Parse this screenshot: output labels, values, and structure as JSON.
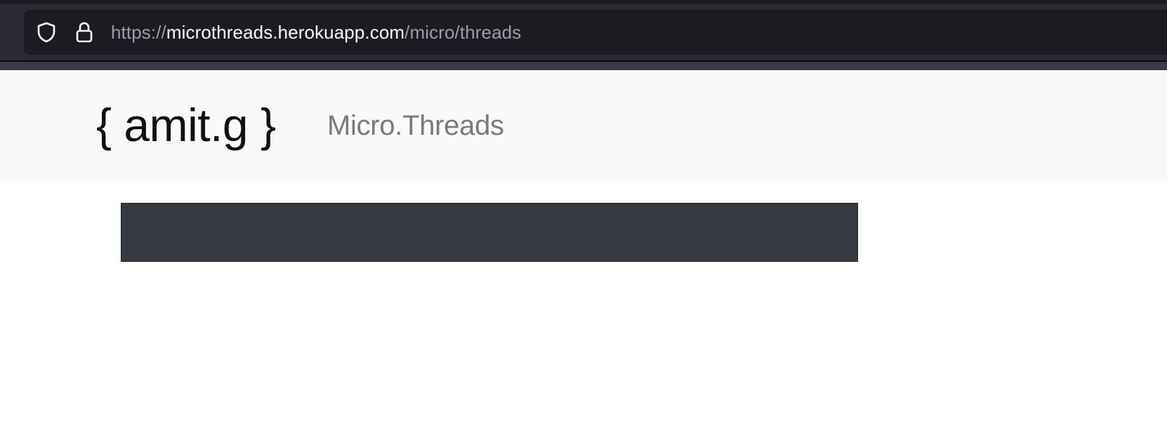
{
  "browser": {
    "url": {
      "scheme": "https://",
      "host": "microthreads.herokuapp.com",
      "path": "/micro/threads"
    },
    "icons": [
      "shield-icon",
      "lock-icon"
    ]
  },
  "header": {
    "brand": "{ amit.g }",
    "nav_link": "Micro.Threads"
  },
  "colors": {
    "chrome_bg": "#2b2a33",
    "urlbar_bg": "#1c1b22",
    "header_bg": "#f9f9f9",
    "panel_bg": "#343a40"
  }
}
